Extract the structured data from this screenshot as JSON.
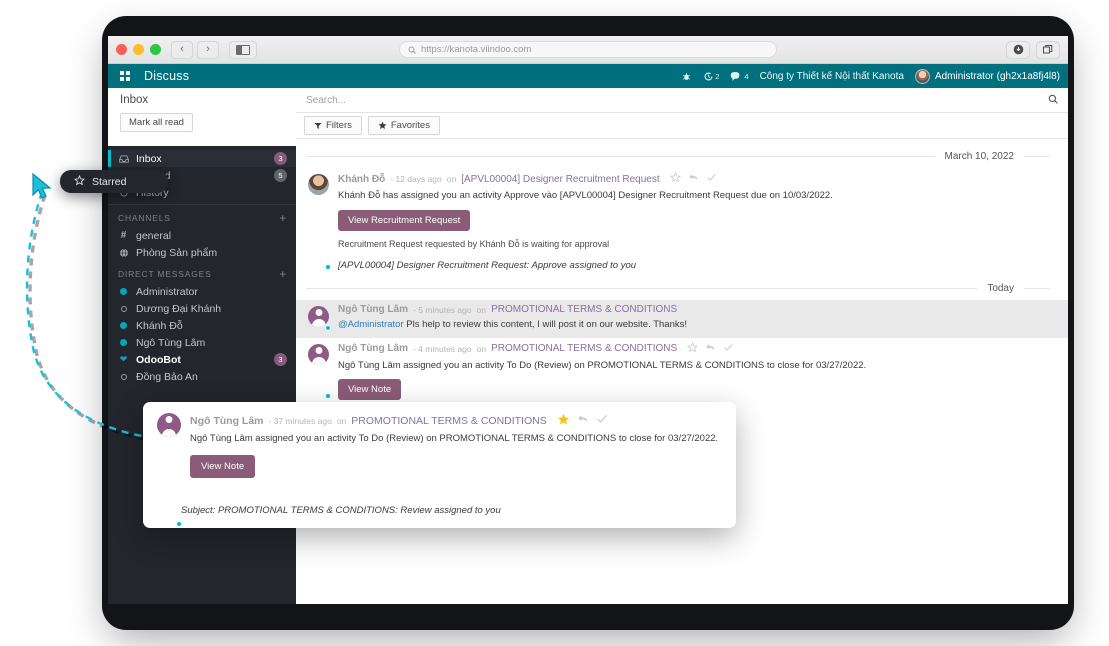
{
  "browser": {
    "url": "https://kanota.viindoo.com",
    "back_label": "‹",
    "forward_label": "›",
    "sidebar_toggle_name": "sidebar-toggle",
    "download_name": "download-icon",
    "tabs_name": "tab-overview-icon"
  },
  "appbar": {
    "title": "Discuss",
    "activities_badge": "2",
    "messages_badge": "4",
    "company": "Công ty Thiết kế Nội thất Kanota",
    "user": "Administrator (gh2x1a8fj4l8)"
  },
  "sidebar": {
    "mailboxes": [
      {
        "label": "Inbox",
        "icon": "inbox-icon",
        "badge": "3",
        "badge_style": "purple",
        "active": true
      },
      {
        "label": "Starred",
        "icon": "star-icon",
        "badge": "5",
        "badge_style": "grey",
        "active": false
      },
      {
        "label": "History",
        "icon": "history-icon",
        "badge": "",
        "badge_style": "",
        "active": false
      }
    ],
    "channels_header": "CHANNELS",
    "channels": [
      {
        "label": "general",
        "icon": "hash-icon"
      },
      {
        "label": "Phòng Sản phẩm",
        "icon": "globe-icon"
      }
    ],
    "dm_header": "DIRECT MESSAGES",
    "direct_messages": [
      {
        "label": "Administrator",
        "status": "online",
        "badge": "",
        "bold": false
      },
      {
        "label": "Dương Đại Khánh",
        "status": "offline",
        "badge": "",
        "bold": false
      },
      {
        "label": "Khánh Đỗ",
        "status": "online",
        "badge": "",
        "bold": false
      },
      {
        "label": "Ngô Tùng Lâm",
        "status": "online",
        "badge": "",
        "bold": false
      },
      {
        "label": "OdooBot",
        "status": "bot",
        "badge": "3",
        "bold": true
      },
      {
        "label": "Đồng Bảo An",
        "status": "offline",
        "badge": "",
        "bold": false
      }
    ],
    "add_channel_label": "+",
    "add_dm_label": "+"
  },
  "controlpanel": {
    "breadcrumb": "Inbox",
    "mark_all_read": "Mark all read",
    "search_placeholder": "Search...",
    "filters_label": "Filters",
    "favorites_label": "Favorites"
  },
  "messages": {
    "groups": [
      {
        "date_label": "March 10, 2022",
        "items": [
          {
            "author": "Khánh Đỗ",
            "time": "- 12 days ago",
            "on_label": "on",
            "subject": "[APVL00004] Designer Recruitment Request",
            "avatar": "photo",
            "status": "online",
            "starred": false,
            "highlight": false,
            "body": "Khánh Đỗ has assigned you an activity Approve vào [APVL00004] Designer Recruitment Request due on 10/03/2022.",
            "button": "View Recruitment Request",
            "note": "Recruitment Request requested by Khánh Đỗ is waiting for approval",
            "footer": "[APVL00004] Designer Recruitment Request: Approve assigned to you"
          }
        ]
      },
      {
        "date_label": "Today",
        "items": [
          {
            "author": "Ngô Tùng Lâm",
            "time": "- 5 minutes ago",
            "on_label": "on",
            "subject": "PROMOTIONAL TERMS & CONDITIONS",
            "avatar": "anon",
            "status": "online",
            "starred": false,
            "highlight": true,
            "mention": "@Administrator",
            "body": " Pls help to review this content, I will post it on our website. Thanks!",
            "button": "",
            "note": "",
            "footer": ""
          },
          {
            "author": "Ngô Tùng Lâm",
            "time": "- 4 minutes ago",
            "on_label": "on",
            "subject": "PROMOTIONAL TERMS & CONDITIONS",
            "avatar": "anon",
            "status": "online",
            "starred": false,
            "highlight": false,
            "body": "Ngô Tùng Lâm assigned you an activity To Do (Review) on PROMOTIONAL TERMS & CONDITIONS to close for 03/27/2022.",
            "button": "View Note",
            "note": "",
            "footer": ""
          }
        ]
      }
    ]
  },
  "float_tooltip": {
    "label": "Starred",
    "icon": "star-outline-icon"
  },
  "float_card": {
    "author": "Ngô Tùng Lâm",
    "time": "- 37 minutes ago",
    "on_label": "on",
    "subject": "PROMOTIONAL TERMS & CONDITIONS",
    "body": "Ngô Tùng Lâm assigned you an activity To Do (Review) on PROMOTIONAL TERMS & CONDITIONS to close for 03/27/2022.",
    "button": "View Note",
    "footer": "Subject: PROMOTIONAL TERMS & CONDITIONS: Review assigned to you",
    "starred": true
  },
  "colors": {
    "appbar_teal": "#00707f",
    "sidebar_dark": "#23262d",
    "accent_cyan": "#00bcd4",
    "badge_purple": "#875A7B",
    "button_purple": "#8b5c78",
    "star_yellow": "#f5c325"
  }
}
